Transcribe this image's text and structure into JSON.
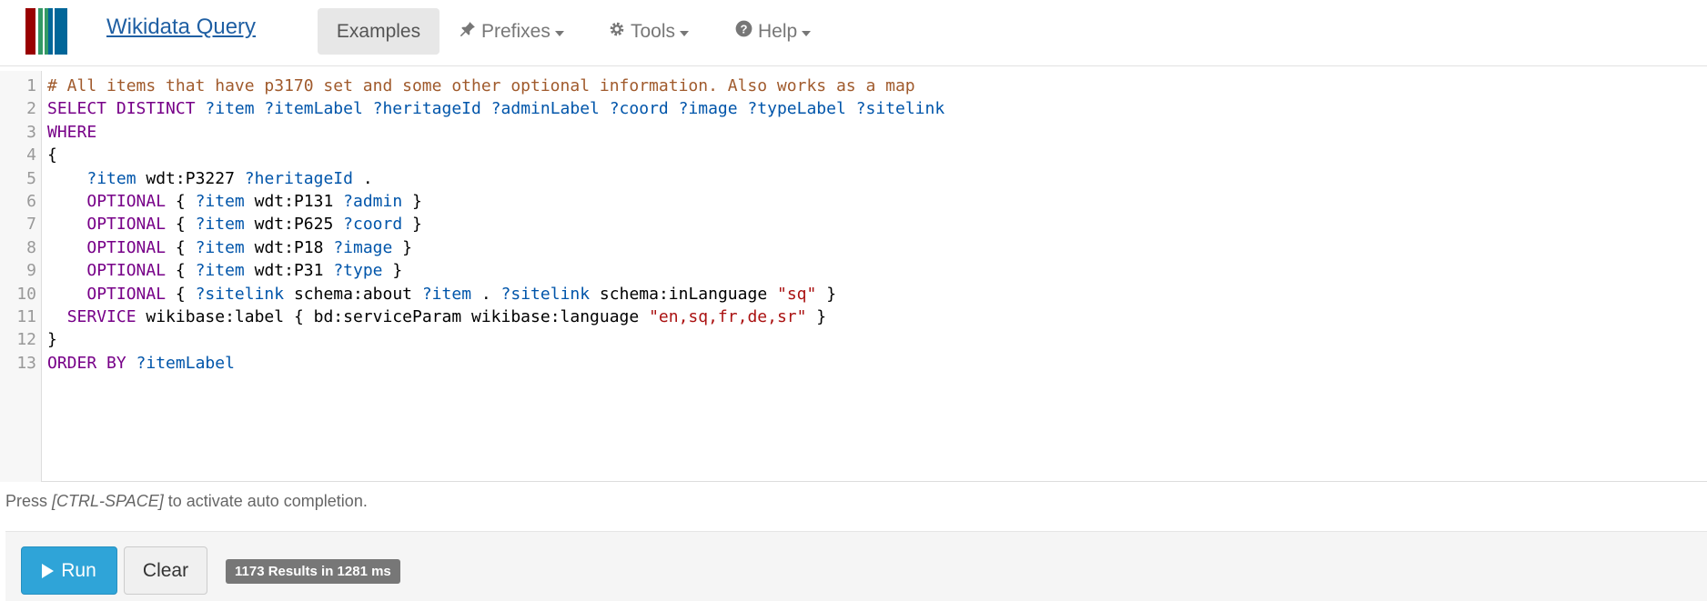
{
  "navbar": {
    "brand": "Wikidata Query",
    "logo_colors": [
      "#990000",
      "#339966",
      "#006699"
    ],
    "items": [
      {
        "label": "Examples",
        "icon": "",
        "active": true
      },
      {
        "label": "Prefixes",
        "icon": "pushpin-icon",
        "dropdown": true
      },
      {
        "label": "Tools",
        "icon": "gear-icon",
        "dropdown": true
      },
      {
        "label": "Help",
        "icon": "question-circle-icon",
        "dropdown": true
      }
    ]
  },
  "editor": {
    "lines": [
      {
        "num": "1",
        "tokens": [
          {
            "t": "# All items that have p3170 set and some other optional information. Also works as a map",
            "c": "comment"
          }
        ]
      },
      {
        "num": "2",
        "tokens": [
          {
            "t": "SELECT DISTINCT",
            "c": "kw"
          },
          {
            "t": " ",
            "c": ""
          },
          {
            "t": "?item ?itemLabel ?heritageId ?adminLabel ?coord ?image ?typeLabel ?sitelink",
            "c": "var"
          }
        ]
      },
      {
        "num": "3",
        "tokens": [
          {
            "t": "WHERE",
            "c": "kw"
          }
        ]
      },
      {
        "num": "4",
        "tokens": [
          {
            "t": "{",
            "c": ""
          }
        ]
      },
      {
        "num": "5",
        "tokens": [
          {
            "t": "    ",
            "c": ""
          },
          {
            "t": "?item",
            "c": "var"
          },
          {
            "t": " wdt:P3227 ",
            "c": ""
          },
          {
            "t": "?heritageId",
            "c": "var"
          },
          {
            "t": " .",
            "c": ""
          }
        ]
      },
      {
        "num": "6",
        "tokens": [
          {
            "t": "    ",
            "c": ""
          },
          {
            "t": "OPTIONAL",
            "c": "kw"
          },
          {
            "t": " { ",
            "c": ""
          },
          {
            "t": "?item",
            "c": "var"
          },
          {
            "t": " wdt:P131 ",
            "c": ""
          },
          {
            "t": "?admin",
            "c": "var"
          },
          {
            "t": " }",
            "c": ""
          }
        ]
      },
      {
        "num": "7",
        "tokens": [
          {
            "t": "    ",
            "c": ""
          },
          {
            "t": "OPTIONAL",
            "c": "kw"
          },
          {
            "t": " { ",
            "c": ""
          },
          {
            "t": "?item",
            "c": "var"
          },
          {
            "t": " wdt:P625 ",
            "c": ""
          },
          {
            "t": "?coord",
            "c": "var"
          },
          {
            "t": " }",
            "c": ""
          }
        ]
      },
      {
        "num": "8",
        "tokens": [
          {
            "t": "    ",
            "c": ""
          },
          {
            "t": "OPTIONAL",
            "c": "kw"
          },
          {
            "t": " { ",
            "c": ""
          },
          {
            "t": "?item",
            "c": "var"
          },
          {
            "t": " wdt:P18 ",
            "c": ""
          },
          {
            "t": "?image",
            "c": "var"
          },
          {
            "t": " }",
            "c": ""
          }
        ]
      },
      {
        "num": "9",
        "tokens": [
          {
            "t": "    ",
            "c": ""
          },
          {
            "t": "OPTIONAL",
            "c": "kw"
          },
          {
            "t": " { ",
            "c": ""
          },
          {
            "t": "?item",
            "c": "var"
          },
          {
            "t": " wdt:P31 ",
            "c": ""
          },
          {
            "t": "?type",
            "c": "var"
          },
          {
            "t": " }",
            "c": ""
          }
        ]
      },
      {
        "num": "10",
        "tokens": [
          {
            "t": "    ",
            "c": ""
          },
          {
            "t": "OPTIONAL",
            "c": "kw"
          },
          {
            "t": " { ",
            "c": ""
          },
          {
            "t": "?sitelink",
            "c": "var"
          },
          {
            "t": " schema:about ",
            "c": ""
          },
          {
            "t": "?item",
            "c": "var"
          },
          {
            "t": " . ",
            "c": ""
          },
          {
            "t": "?sitelink",
            "c": "var"
          },
          {
            "t": " schema:inLanguage ",
            "c": ""
          },
          {
            "t": "\"sq\"",
            "c": "str"
          },
          {
            "t": " }",
            "c": ""
          }
        ]
      },
      {
        "num": "11",
        "tokens": [
          {
            "t": "  ",
            "c": ""
          },
          {
            "t": "SERVICE",
            "c": "kw"
          },
          {
            "t": " wikibase:label { bd:serviceParam wikibase:language ",
            "c": ""
          },
          {
            "t": "\"en,sq,fr,de,sr\"",
            "c": "str"
          },
          {
            "t": " }",
            "c": ""
          }
        ]
      },
      {
        "num": "12",
        "tokens": [
          {
            "t": "}",
            "c": ""
          }
        ]
      },
      {
        "num": "13",
        "tokens": [
          {
            "t": "ORDER BY",
            "c": "kw"
          },
          {
            "t": " ",
            "c": ""
          },
          {
            "t": "?itemLabel",
            "c": "var"
          }
        ]
      }
    ]
  },
  "hint": {
    "prefix": "Press ",
    "key": "[CTRL-SPACE]",
    "suffix": " to activate auto completion."
  },
  "actions": {
    "run_label": "Run",
    "clear_label": "Clear",
    "results_badge": "1173 Results in 1281 ms"
  }
}
